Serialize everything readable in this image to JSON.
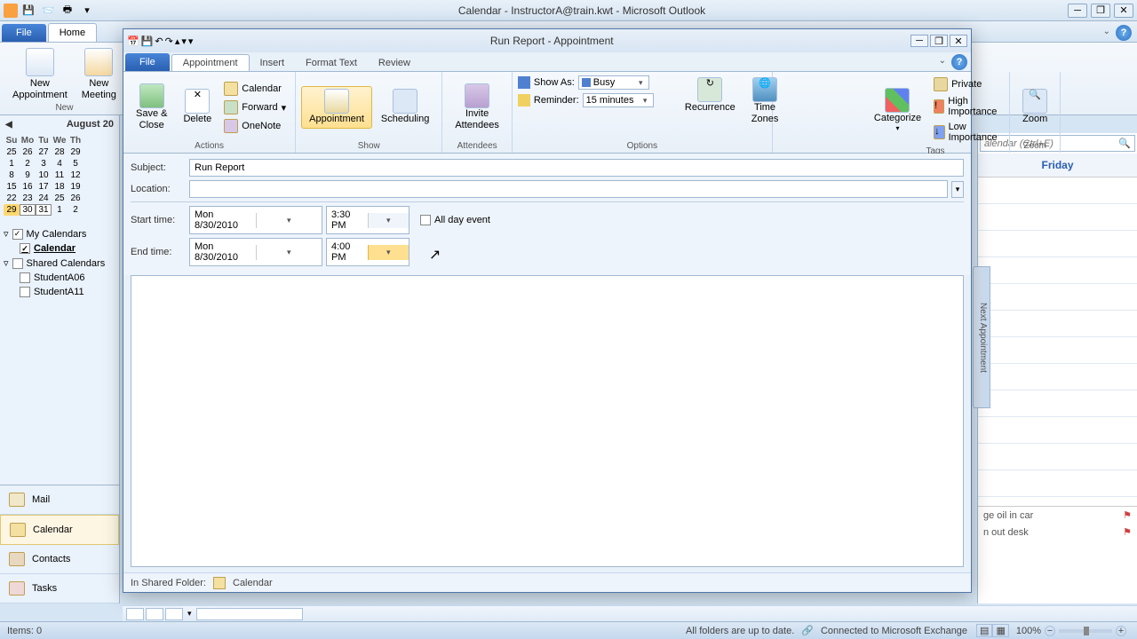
{
  "app": {
    "title": "Calendar - InstructorA@train.kwt - Microsoft Outlook"
  },
  "mainTabs": {
    "file": "File",
    "home": "Home"
  },
  "mainRibbon": {
    "newAppt": "New\nAppointment",
    "newMeeting": "New\nMeeting",
    "groupNew": "New"
  },
  "miniCal": {
    "month": "August 20",
    "dow": [
      "Su",
      "Mo",
      "Tu",
      "We",
      "Th"
    ],
    "rows": [
      [
        "25",
        "26",
        "27",
        "28",
        "29"
      ],
      [
        "1",
        "2",
        "3",
        "4",
        "5"
      ],
      [
        "8",
        "9",
        "10",
        "11",
        "12"
      ],
      [
        "15",
        "16",
        "17",
        "18",
        "19"
      ],
      [
        "22",
        "23",
        "24",
        "25",
        "26"
      ],
      [
        "29",
        "30",
        "31",
        "1",
        "2"
      ]
    ]
  },
  "calTree": {
    "myCalendars": "My Calendars",
    "calendar": "Calendar",
    "sharedCalendars": "Shared Calendars",
    "studentA06": "StudentA06",
    "studentA11": "StudentA11"
  },
  "nav": {
    "mail": "Mail",
    "calendar": "Calendar",
    "contacts": "Contacts",
    "tasks": "Tasks"
  },
  "search": {
    "placeholder": "alendar (Ctrl+E)"
  },
  "dayView": {
    "header": "Friday",
    "tasks": [
      "ge oil in car",
      "n out desk"
    ],
    "newApptTab": "Next Appointment"
  },
  "dialog": {
    "title": "Run Report - Appointment",
    "tabs": {
      "file": "File",
      "appointment": "Appointment",
      "insert": "Insert",
      "formatText": "Format Text",
      "review": "Review"
    },
    "ribbon": {
      "saveClose": "Save &\nClose",
      "delete": "Delete",
      "calendar": "Calendar",
      "forward": "Forward",
      "onenote": "OneNote",
      "actionsGroup": "Actions",
      "appointment": "Appointment",
      "scheduling": "Scheduling",
      "showGroup": "Show",
      "invite": "Invite\nAttendees",
      "attendeesGroup": "Attendees",
      "showAs": "Show As:",
      "showAsValue": "Busy",
      "reminder": "Reminder:",
      "reminderValue": "15 minutes",
      "recurrence": "Recurrence",
      "timeZones": "Time\nZones",
      "optionsGroup": "Options",
      "categorize": "Categorize",
      "private": "Private",
      "highImp": "High Importance",
      "lowImp": "Low Importance",
      "tagsGroup": "Tags",
      "zoom": "Zoom",
      "zoomGroup": "Zoom"
    },
    "form": {
      "subjectLabel": "Subject:",
      "subjectValue": "Run Report",
      "locationLabel": "Location:",
      "locationValue": "",
      "startLabel": "Start time:",
      "startDate": "Mon 8/30/2010",
      "startTime": "3:30 PM",
      "endLabel": "End time:",
      "endDate": "Mon 8/30/2010",
      "endTime": "4:00 PM",
      "allDay": "All day event"
    },
    "status": {
      "sharedFolder": "In Shared Folder:",
      "folderName": "Calendar"
    }
  },
  "statusbar": {
    "items": "Items: 0",
    "folders": "All folders are up to date.",
    "connected": "Connected to Microsoft Exchange",
    "zoom": "100%"
  }
}
